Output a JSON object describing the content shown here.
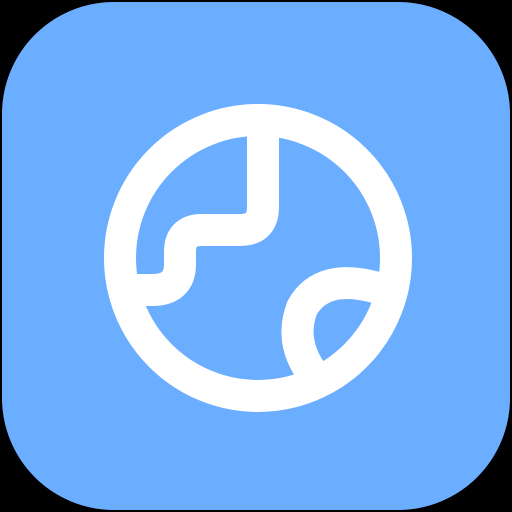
{
  "app_icon": {
    "icon": "globe-icon",
    "background_color": "#6BAEFF",
    "glyph_color": "#FFFFFF",
    "outer_background_color": "#000000"
  }
}
